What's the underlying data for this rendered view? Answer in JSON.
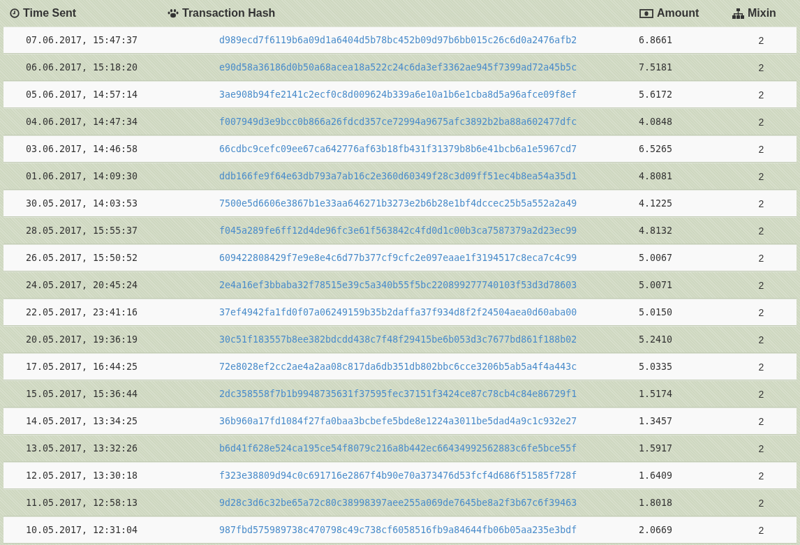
{
  "table": {
    "columns": [
      {
        "kind": "time",
        "label": "Time Sent"
      },
      {
        "kind": "hash",
        "label": "Transaction Hash"
      },
      {
        "kind": "amount",
        "label": "Amount"
      },
      {
        "kind": "mixin",
        "label": "Mixin"
      }
    ],
    "rows": [
      {
        "time": "07.06.2017, 15:47:37",
        "hash": "d989ecd7f6119b6a09d1a6404d5b78bc452b09d97b6bb015c26c6d0a2476afb2",
        "amount": "6.8661",
        "mixin": "2"
      },
      {
        "time": "06.06.2017, 15:18:20",
        "hash": "e90d58a36186d0b50a68acea18a522c24c6da3ef3362ae945f7399ad72a45b5c",
        "amount": "7.5181",
        "mixin": "2"
      },
      {
        "time": "05.06.2017, 14:57:14",
        "hash": "3ae908b94fe2141c2ecf0c8d009624b339a6e10a1b6e1cba8d5a96afce09f8ef",
        "amount": "5.6172",
        "mixin": "2"
      },
      {
        "time": "04.06.2017, 14:47:34",
        "hash": "f007949d3e9bcc0b866a26fdcd357ce72994a9675afc3892b2ba88a602477dfc",
        "amount": "4.0848",
        "mixin": "2"
      },
      {
        "time": "03.06.2017, 14:46:58",
        "hash": "66cdbc9cefc09ee67ca642776af63b18fb431f31379b8b6e41bcb6a1e5967cd7",
        "amount": "6.5265",
        "mixin": "2"
      },
      {
        "time": "01.06.2017, 14:09:30",
        "hash": "ddb166fe9f64e63db793a7ab16c2e360d60349f28c3d09ff51ec4b8ea54a35d1",
        "amount": "4.8081",
        "mixin": "2"
      },
      {
        "time": "30.05.2017, 14:03:53",
        "hash": "7500e5d6606e3867b1e33aa646271b3273e2b6b28e1bf4dccec25b5a552a2a49",
        "amount": "4.1225",
        "mixin": "2"
      },
      {
        "time": "28.05.2017, 15:55:37",
        "hash": "f045a289fe6ff12d4de96fc3e61f563842c4fd0d1c00b3ca7587379a2d23ec99",
        "amount": "4.8132",
        "mixin": "2"
      },
      {
        "time": "26.05.2017, 15:50:52",
        "hash": "609422808429f7e9e8e4c6d77b377cf9cfc2e097eaae1f3194517c8eca7c4c99",
        "amount": "5.0067",
        "mixin": "2"
      },
      {
        "time": "24.05.2017, 20:45:24",
        "hash": "2e4a16ef3bbaba32f78515e39c5a340b55f5bc220899277740103f53d3d78603",
        "amount": "5.0071",
        "mixin": "2"
      },
      {
        "time": "22.05.2017, 23:41:16",
        "hash": "37ef4942fa1fd0f07a06249159b35b2daffa37f934d8f2f24504aea0d60aba00",
        "amount": "5.0150",
        "mixin": "2"
      },
      {
        "time": "20.05.2017, 19:36:19",
        "hash": "30c51f183557b8ee382bdcdd438c7f48f29415be6b053d3c7677bd861f188b02",
        "amount": "5.2410",
        "mixin": "2"
      },
      {
        "time": "17.05.2017, 16:44:25",
        "hash": "72e8028ef2cc2ae4a2aa08c817da6db351db802bbc6cce3206b5ab5a4f4a443c",
        "amount": "5.0335",
        "mixin": "2"
      },
      {
        "time": "15.05.2017, 15:36:44",
        "hash": "2dc358558f7b1b9948735631f37595fec37151f3424ce87c78cb4c84e86729f1",
        "amount": "1.5174",
        "mixin": "2"
      },
      {
        "time": "14.05.2017, 13:34:25",
        "hash": "36b960a17fd1084f27fa0baa3bcbefe5bde8e1224a3011be5dad4a9c1c932e27",
        "amount": "1.3457",
        "mixin": "2"
      },
      {
        "time": "13.05.2017, 13:32:26",
        "hash": "b6d41f628e524ca195ce54f8079c216a8b442ec66434992562883c6fe5bce55f",
        "amount": "1.5917",
        "mixin": "2"
      },
      {
        "time": "12.05.2017, 13:30:18",
        "hash": "f323e38809d94c0c691716e2867f4b90e70a373476d53fcf4d686f51585f728f",
        "amount": "1.6409",
        "mixin": "2"
      },
      {
        "time": "11.05.2017, 12:58:13",
        "hash": "9d28c3d6c32be65a72c80c38998397aee255a069de7645be8a2f3b67c6f39463",
        "amount": "1.8018",
        "mixin": "2"
      },
      {
        "time": "10.05.2017, 12:31:04",
        "hash": "987fbd575989738c470798c49c738cf6058516fb9a84644fb06b05aa235e3bdf",
        "amount": "2.0669",
        "mixin": "2"
      }
    ]
  }
}
